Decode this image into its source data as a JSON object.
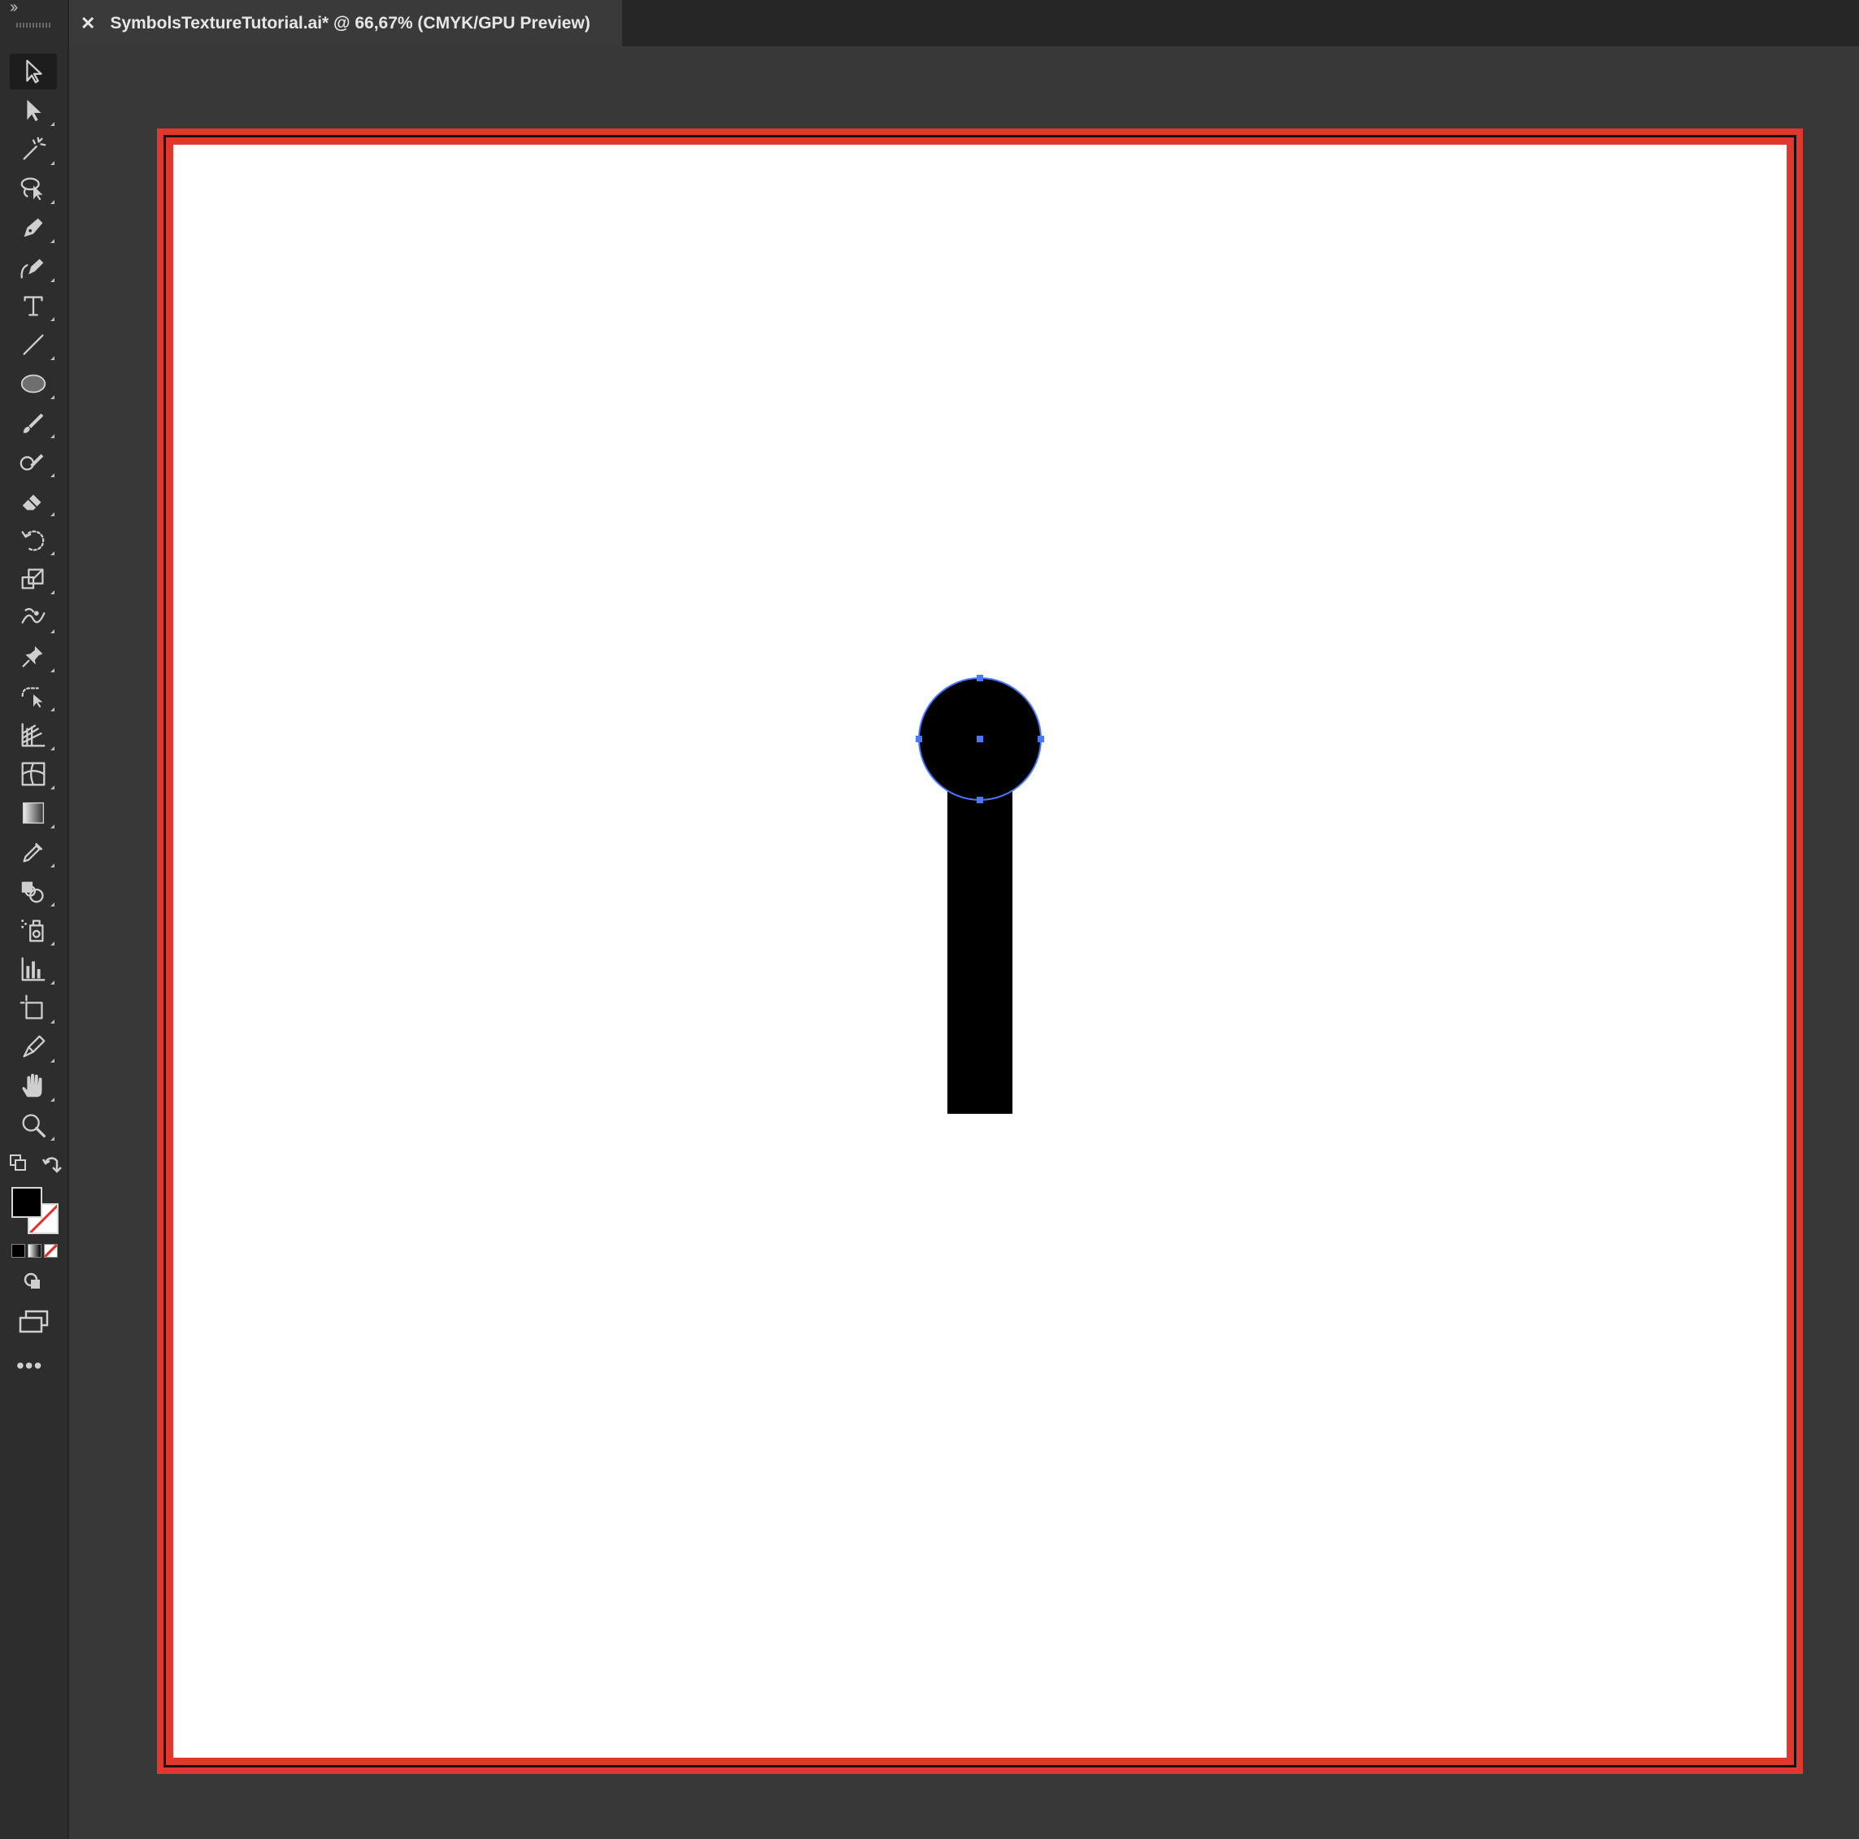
{
  "toolbar": {
    "collapse_label": "››",
    "tools": [
      {
        "name": "selection-tool",
        "icon": "selection-arrow-icon",
        "active": true
      },
      {
        "name": "direct-selection-tool",
        "icon": "direct-selection-arrow-icon"
      },
      {
        "name": "magic-wand-tool",
        "icon": "magic-wand-icon"
      },
      {
        "name": "lasso-tool",
        "icon": "lasso-icon"
      },
      {
        "name": "pen-tool",
        "icon": "pen-icon"
      },
      {
        "name": "curvature-tool",
        "icon": "curvature-pen-icon"
      },
      {
        "name": "type-tool",
        "icon": "type-icon",
        "glyph": "T"
      },
      {
        "name": "line-segment-tool",
        "icon": "line-segment-icon"
      },
      {
        "name": "ellipse-tool",
        "icon": "ellipse-icon"
      },
      {
        "name": "paintbrush-tool",
        "icon": "paintbrush-icon"
      },
      {
        "name": "blob-brush-tool",
        "icon": "blob-brush-icon"
      },
      {
        "name": "eraser-tool",
        "icon": "eraser-icon"
      },
      {
        "name": "rotate-tool",
        "icon": "rotate-icon"
      },
      {
        "name": "scale-tool",
        "icon": "scale-icon"
      },
      {
        "name": "warp-tool",
        "icon": "warp-icon"
      },
      {
        "name": "puppet-warp-tool",
        "icon": "pin-icon"
      },
      {
        "name": "free-transform-tool",
        "icon": "free-transform-icon"
      },
      {
        "name": "perspective-grid-tool",
        "icon": "perspective-grid-icon"
      },
      {
        "name": "mesh-tool",
        "icon": "mesh-icon"
      },
      {
        "name": "gradient-tool",
        "icon": "gradient-icon"
      },
      {
        "name": "eyedropper-tool",
        "icon": "eyedropper-icon"
      },
      {
        "name": "shape-builder-tool",
        "icon": "shape-builder-icon"
      },
      {
        "name": "symbol-sprayer-tool",
        "icon": "symbol-sprayer-icon"
      },
      {
        "name": "column-graph-tool",
        "icon": "column-graph-icon"
      },
      {
        "name": "artboard-tool",
        "icon": "artboard-icon"
      },
      {
        "name": "slice-tool",
        "icon": "slice-icon"
      },
      {
        "name": "hand-tool",
        "icon": "hand-icon"
      },
      {
        "name": "zoom-tool",
        "icon": "zoom-icon"
      }
    ],
    "fill_color": "#000000",
    "stroke_color": "none",
    "more_label": "•••"
  },
  "document": {
    "tab_title": "SymbolsTextureTutorial.ai* @ 66,67% (CMYK/GPU Preview)",
    "close_glyph": "✕"
  },
  "colors": {
    "bleed": "#e0382f",
    "artboard": "#ffffff",
    "selection": "#4a78ff",
    "shape_fill": "#000000"
  }
}
